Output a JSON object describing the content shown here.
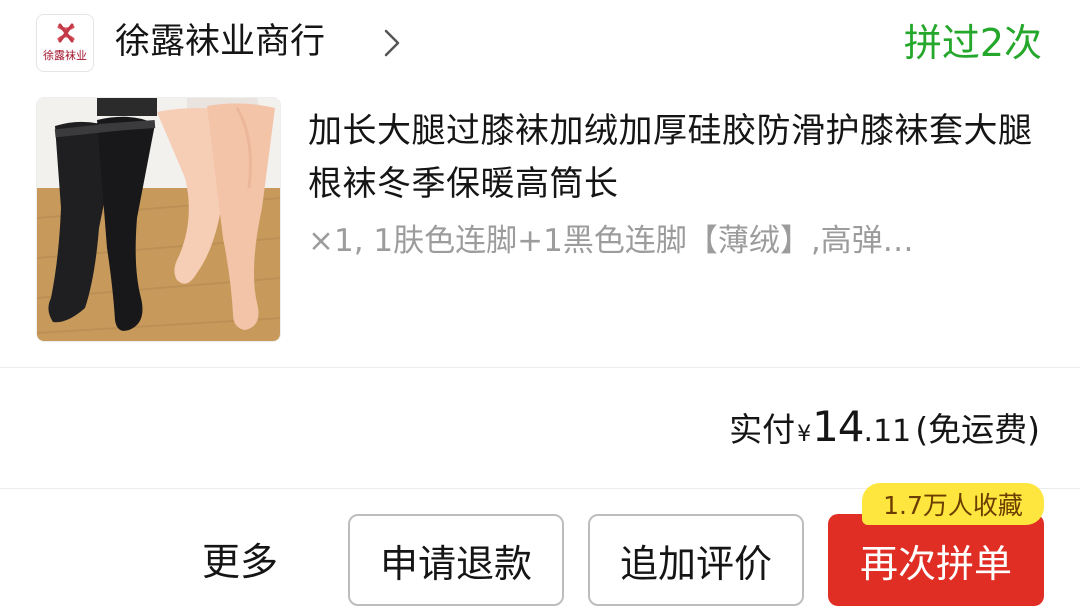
{
  "shop": {
    "logo_text": "徐露袜业",
    "name": "徐露袜业商行",
    "group_count": "拼过2次"
  },
  "product": {
    "title": "加长大腿过膝袜加绒加厚硅胶防滑护膝袜套大腿根袜冬季保暖高筒长",
    "sku": "×1,  1肤色连脚+1黑色连脚【薄绒】,高弹…"
  },
  "payment": {
    "label": "实付",
    "currency": "¥",
    "amount_int": "14",
    "amount_dec": ".11",
    "shipping": "(免运费)"
  },
  "actions": {
    "more": "更多",
    "refund": "申请退款",
    "review": "追加评价",
    "reorder": "再次拼单",
    "fav_badge": "1.7万人收藏"
  },
  "colors": {
    "accent_red": "#e02e24",
    "group_green": "#25a72b",
    "badge_yellow": "#ffe63e"
  }
}
